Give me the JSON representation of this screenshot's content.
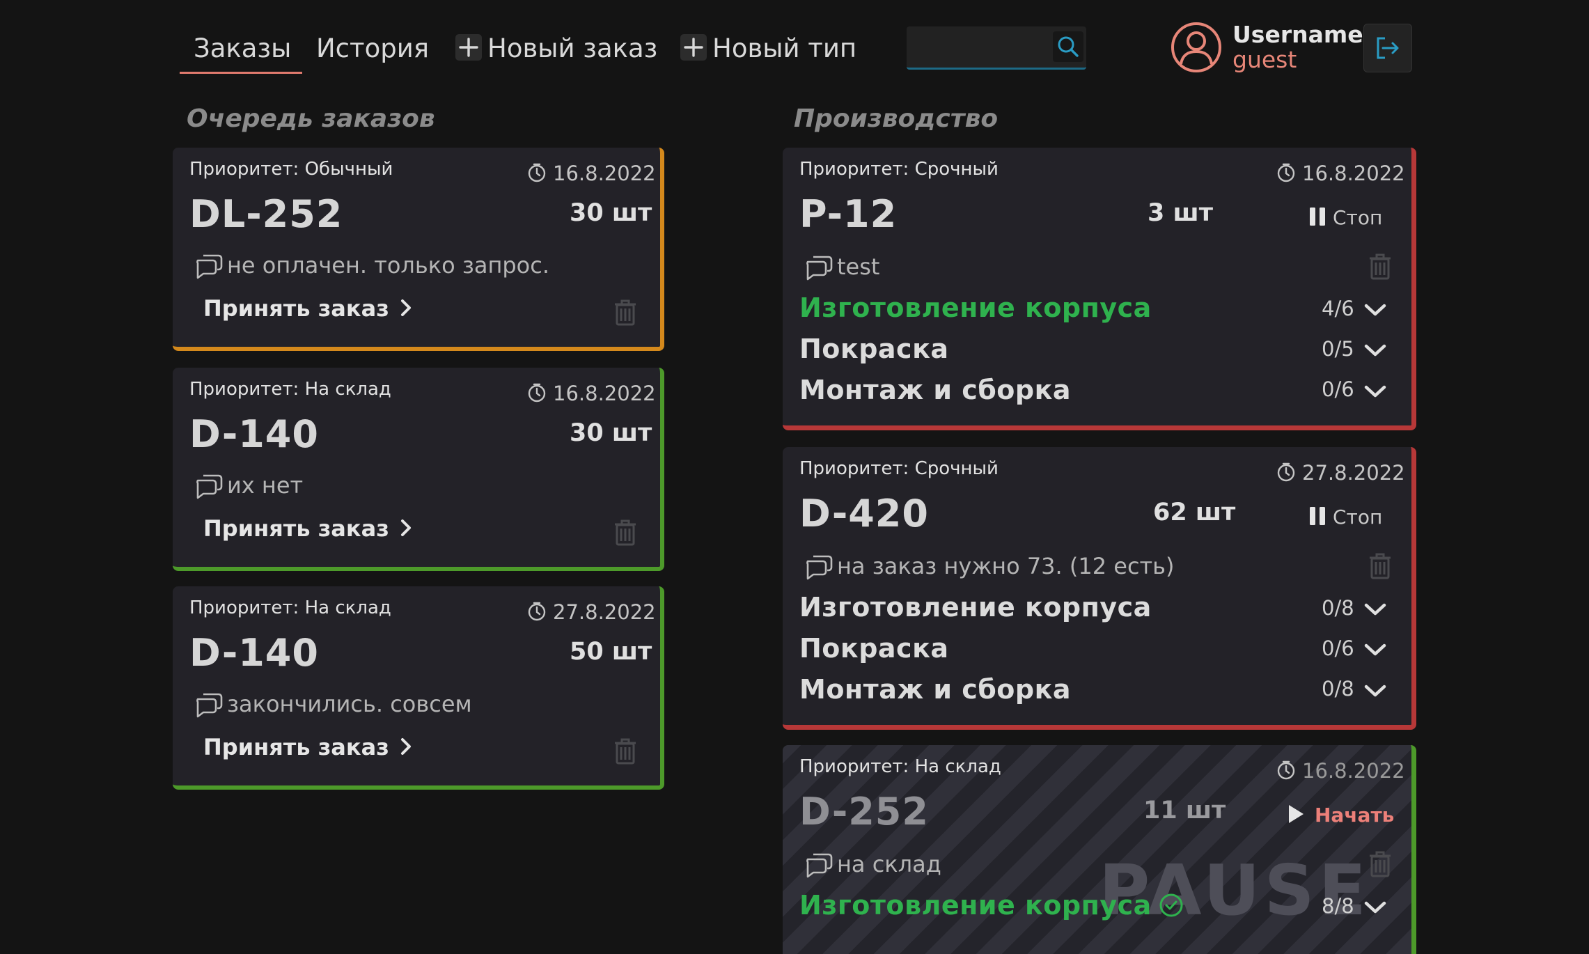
{
  "nav": {
    "tabs": [
      {
        "label": "Заказы",
        "active": true
      },
      {
        "label": "История"
      },
      {
        "label": "Новый заказ",
        "icon": "plus-icon"
      },
      {
        "label": "Новый тип",
        "icon": "plus-icon"
      }
    ],
    "search": {
      "placeholder": "",
      "icon": "search-icon"
    },
    "user": {
      "name": "Username",
      "role": "guest",
      "avatar_icon": "user-avatar-icon",
      "logout_icon": "logout-icon"
    }
  },
  "queue": {
    "title": "Очередь заказов",
    "cards": [
      {
        "priority": "Приоритет: Обычный",
        "date": "16.8.2022",
        "code": "DL-252",
        "qty": "30 шт",
        "comment": "не оплачен. только запрос.",
        "action": "Принять заказ",
        "accent": "#d4891c"
      },
      {
        "priority": "Приоритет: На склад",
        "date": "16.8.2022",
        "code": "D-140",
        "qty": "30 шт",
        "comment": "их нет",
        "action": "Принять заказ",
        "accent": "#4d9a2a"
      },
      {
        "priority": "Приоритет: На склад",
        "date": "27.8.2022",
        "code": "D-140",
        "qty": "50 шт",
        "comment": "закончились. совсем",
        "action": "Принять заказ",
        "accent": "#4d9a2a"
      }
    ]
  },
  "production": {
    "title": "Производство",
    "cards": [
      {
        "priority": "Приоритет: Срочный",
        "date": "16.8.2022",
        "code": "P-12",
        "qty": "3 шт",
        "control": "Стоп",
        "comment": "test",
        "accent": "#b73838",
        "stages": [
          {
            "name": "Изготовление корпуса",
            "progress": "4/6"
          },
          {
            "name": "Покраска",
            "progress": "0/5"
          },
          {
            "name": "Монтаж и сборка",
            "progress": "0/6"
          }
        ]
      },
      {
        "priority": "Приоритет: Срочный",
        "date": "27.8.2022",
        "code": "D-420",
        "qty": "62 шт",
        "control": "Стоп",
        "comment": "на заказ нужно 73. (12 есть)",
        "accent": "#b73838",
        "stages": [
          {
            "name": "Изготовление корпуса",
            "progress": "0/8"
          },
          {
            "name": "Покраска",
            "progress": "0/6"
          },
          {
            "name": "Монтаж и сборка",
            "progress": "0/8"
          }
        ]
      },
      {
        "priority": "Приоритет: На склад",
        "date": "16.8.2022",
        "code": "D-252",
        "qty": "11 шт",
        "control": "Начать",
        "comment": "на склад",
        "accent": "#4d9a2a",
        "overlay": "PAUSE",
        "stages": [
          {
            "name": "Изготовление корпуса",
            "progress": "8/8"
          }
        ]
      }
    ]
  }
}
